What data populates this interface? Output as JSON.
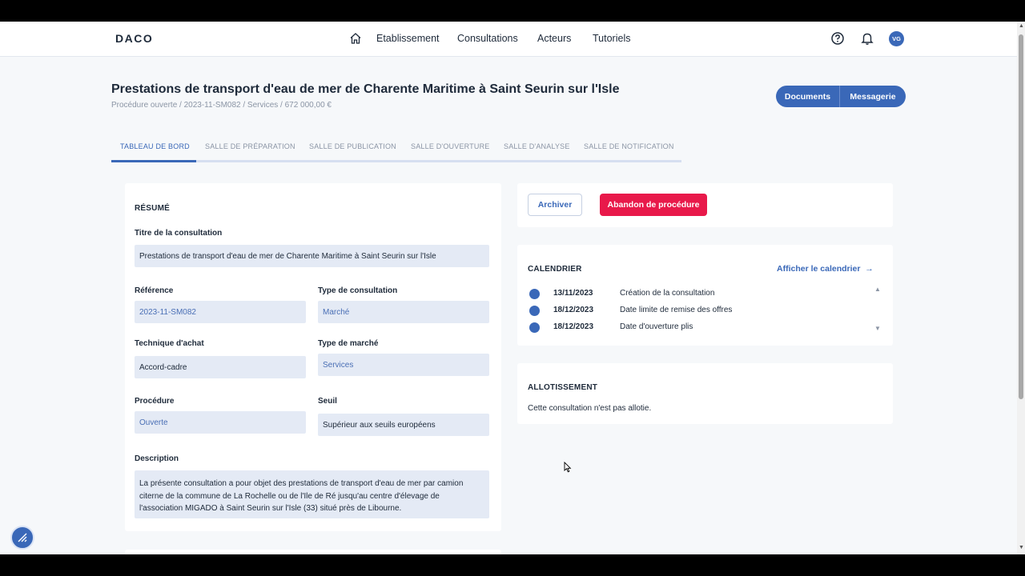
{
  "header": {
    "logo": "DACO",
    "nav": [
      "Etablissement",
      "Consultations",
      "Acteurs",
      "Tutoriels"
    ],
    "avatar_initials": "VG"
  },
  "page": {
    "title": "Prestations de transport d'eau de mer de Charente Maritime à Saint Seurin sur l'Isle",
    "subtitle": "Procédure ouverte / 2023-11-SM082 / Services / 672 000,00 €",
    "buttons": {
      "documents": "Documents",
      "messagerie": "Messagerie"
    }
  },
  "tabs": [
    "TABLEAU DE BORD",
    "SALLE DE PRÉPARATION",
    "SALLE DE PUBLICATION",
    "SALLE D'OUVERTURE",
    "SALLE D'ANALYSE",
    "SALLE DE NOTIFICATION"
  ],
  "resume": {
    "title": "RÉSUMÉ",
    "titre_label": "Titre de la consultation",
    "titre_value": "Prestations de transport d'eau de mer de Charente Maritime à Saint Seurin sur l'Isle",
    "reference_label": "Référence",
    "reference_value": "2023-11-SM082",
    "type_consultation_label": "Type de consultation",
    "type_consultation_value": "Marché",
    "technique_label": "Technique d'achat",
    "technique_value": "Accord-cadre",
    "type_marche_label": "Type de marché",
    "type_marche_value": "Services",
    "procedure_label": "Procédure",
    "procedure_value": "Ouverte",
    "seuil_label": "Seuil",
    "seuil_value": "Supérieur aux seuils européens",
    "description_label": "Description",
    "description_lines": [
      "La présente consultation a pour objet des prestations de transport d'eau de mer par camion",
      "citerne de la commune de La Rochelle ou de l'Ile de Ré jusqu'au centre d'élevage de",
      "l'association MIGADO à Saint Seurin sur l'Isle (33) situé près de Libourne."
    ]
  },
  "actions": {
    "archive": "Archiver",
    "abandon": "Abandon de procédure"
  },
  "calendar": {
    "title": "CALENDRIER",
    "link": "Afficher le calendrier",
    "events": [
      {
        "date": "13/11/2023",
        "label": "Création de la consultation"
      },
      {
        "date": "18/12/2023",
        "label": "Date limite de remise des offres"
      },
      {
        "date": "18/12/2023",
        "label": "Date d'ouverture plis"
      }
    ]
  },
  "allotissement": {
    "title": "ALLOTISSEMENT",
    "text": "Cette consultation n'est pas allotie."
  },
  "colors": {
    "primary": "#3a68b8",
    "danger": "#e8194a",
    "field_bg": "#e4eaf5"
  }
}
